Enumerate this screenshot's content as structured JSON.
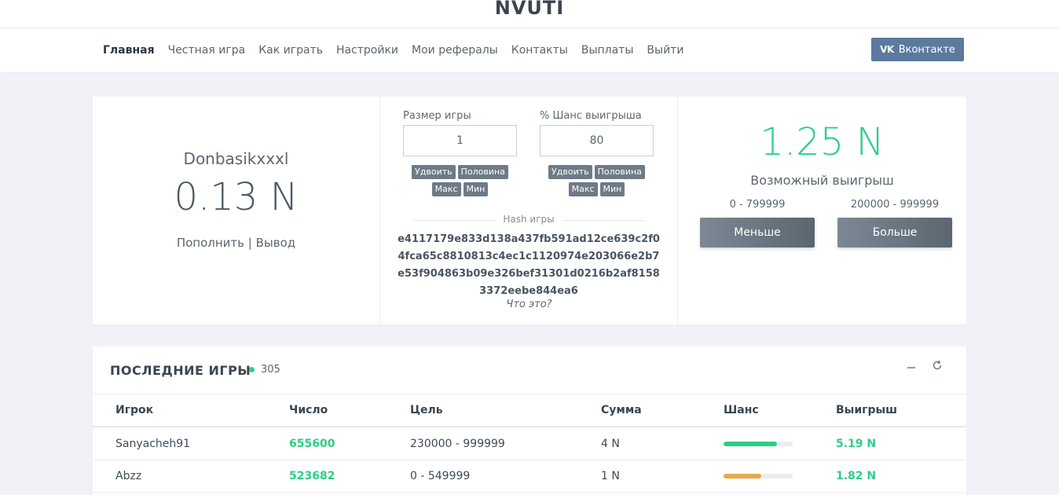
{
  "brand": "NVUTI",
  "nav": {
    "items": [
      "Главная",
      "Честная игра",
      "Как играть",
      "Настройки",
      "Мои рефералы",
      "Контакты",
      "Выплаты",
      "Выйти"
    ],
    "active_index": 0,
    "vk_logo": "VK",
    "vk_label": "Вконтакте"
  },
  "account": {
    "username": "Donbasikxxxl",
    "balance": "0.13 N",
    "deposit": "Пополнить",
    "separator": "|",
    "withdraw": "Вывод"
  },
  "bet": {
    "size_label": "Размер игры",
    "size_value": "1",
    "chance_label": "% Шанс выигрыша",
    "chance_value": "80",
    "size_buttons": [
      "Удвоить",
      "Половина",
      "Макс",
      "Мин"
    ],
    "chance_buttons": [
      "Удвоить",
      "Половина",
      "Макс",
      "Мин"
    ],
    "hash_label": "Hash игры",
    "hash_value": "e4117179e833d138a437fb591ad12ce639c2f04fca65c8810813c4ec1c1120974e203066e2b7e53f904863b09e326bef31301d0216b2af81583372eebe844ea6",
    "what_is": "Что это?"
  },
  "win": {
    "amount": "1.25 N",
    "label": "Возможный выигрыш",
    "low_range": "0 - 799999",
    "high_range": "200000 - 999999",
    "less_button": "Меньше",
    "more_button": "Больше"
  },
  "games": {
    "title": "ПОСЛЕДНИЕ ИГРЫ",
    "count": "305",
    "minimize_icon": "minus-icon",
    "refresh_icon": "refresh-icon",
    "columns": [
      "Игрок",
      "Число",
      "Цель",
      "Сумма",
      "Шанс",
      "Выигрыш"
    ],
    "rows": [
      {
        "player": "Sanyacheh91",
        "number": "655600",
        "target": "230000 - 999999",
        "amount": "4 N",
        "chance": 0.77,
        "chance_color": "#2dce89",
        "win": "5.19 N"
      },
      {
        "player": "Abzz",
        "number": "523682",
        "target": "0 - 549999",
        "amount": "1 N",
        "chance": 0.55,
        "chance_color": "#e8a94a",
        "win": "1.82 N"
      }
    ]
  },
  "colors": {
    "accent_green": "#2dce89",
    "vk_blue": "#5b7a9e",
    "button_gray": "#6e7b87"
  }
}
